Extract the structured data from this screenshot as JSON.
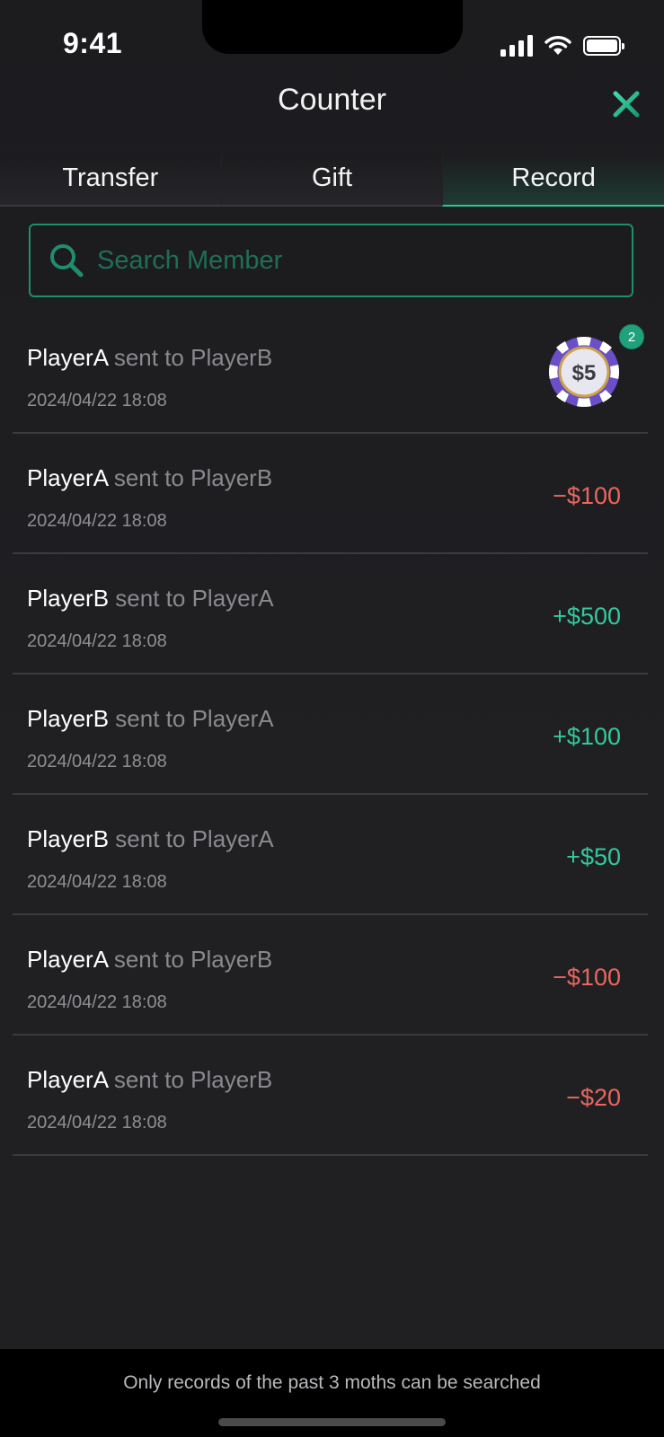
{
  "status_bar": {
    "time": "9:41"
  },
  "header": {
    "title": "Counter"
  },
  "tabs": [
    {
      "label": "Transfer",
      "active": false
    },
    {
      "label": "Gift",
      "active": false
    },
    {
      "label": "Record",
      "active": true
    }
  ],
  "search": {
    "placeholder": "Search Member",
    "value": ""
  },
  "records": [
    {
      "from": "PlayerA",
      "connector": "sent to",
      "to": "PlayerB",
      "date": "2024/04/22 18:08",
      "type": "gift",
      "gift_label": "$5",
      "gift_count": "2"
    },
    {
      "from": "PlayerA",
      "connector": "sent to",
      "to": "PlayerB",
      "date": "2024/04/22 18:08",
      "type": "amount",
      "amount": "−$100",
      "sign": "neg"
    },
    {
      "from": "PlayerB",
      "connector": "sent to",
      "to": "PlayerA",
      "date": "2024/04/22 18:08",
      "type": "amount",
      "amount": "+$500",
      "sign": "pos"
    },
    {
      "from": "PlayerB",
      "connector": "sent to",
      "to": "PlayerA",
      "date": "2024/04/22 18:08",
      "type": "amount",
      "amount": "+$100",
      "sign": "pos"
    },
    {
      "from": "PlayerB",
      "connector": "sent to",
      "to": "PlayerA",
      "date": "2024/04/22 18:08",
      "type": "amount",
      "amount": "+$50",
      "sign": "pos"
    },
    {
      "from": "PlayerA",
      "connector": "sent to",
      "to": "PlayerB",
      "date": "2024/04/22 18:08",
      "type": "amount",
      "amount": "−$100",
      "sign": "neg"
    },
    {
      "from": "PlayerA",
      "connector": "sent to",
      "to": "PlayerB",
      "date": "2024/04/22 18:08",
      "type": "amount",
      "amount": "−$20",
      "sign": "neg"
    }
  ],
  "footer": {
    "note": "Only records of the past 3 moths can be searched"
  },
  "colors": {
    "accent": "#2fc59a",
    "negative": "#e8675f",
    "positive": "#32c99a",
    "background": "#1e1e21"
  },
  "icons": {
    "close": "close-icon",
    "search": "search-icon",
    "gift": "poker-chip-icon"
  }
}
